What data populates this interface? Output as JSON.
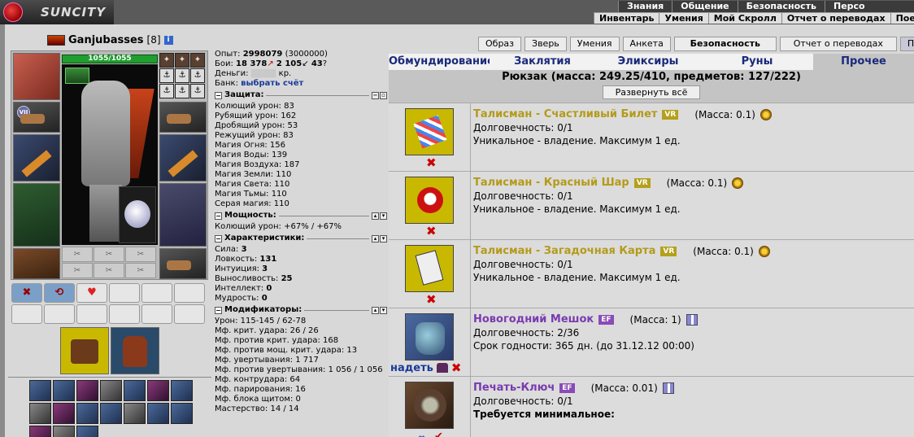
{
  "top": {
    "logo": "SUNCITY",
    "menu1": [
      "Знания",
      "Общение",
      "Безопасность",
      "Персо"
    ],
    "menu2": [
      "Инвентарь",
      "Умения",
      "Мой Скролл",
      "Отчет о переводах",
      "Поединки"
    ]
  },
  "char": {
    "name": "Ganjubasses",
    "level": "[8]",
    "info": "i",
    "hp": "1055/1055",
    "vii": "VII",
    "rings": [
      "✦",
      "✦",
      "✦",
      "⚓",
      "⚓",
      "⚓",
      "⚓",
      "⚓",
      "⚓"
    ],
    "small_slots": [
      "✂",
      "✂",
      "✂",
      "✂",
      "✂",
      "✂"
    ],
    "scrolls": [
      "✖",
      "⟲",
      "♥",
      "",
      "",
      "",
      "",
      "",
      "",
      "",
      "",
      ""
    ]
  },
  "stats": {
    "exp_label": "Опыт:",
    "exp_value": "2998079",
    "exp_next": "(3000000)",
    "fights_label": "Бои:",
    "wins": "18 378",
    "losses": "2 105",
    "draws": "43",
    "money_label": "Деньги:",
    "money_value": "кр.",
    "bank_label": "Банк:",
    "bank_link": "выбрать счёт",
    "sec_defense": "Защита:",
    "defense": [
      "Колющий урон: 83",
      "Рубящий урон: 162",
      "Дробящий урон: 53",
      "Режущий урон: 83",
      "Магия Огня: 156",
      "Магия Воды: 139",
      "Магия Воздуха: 187",
      "Магия Земли: 110",
      "Магия Света: 110",
      "Магия Тьмы: 110",
      "Серая магия: 110"
    ],
    "sec_power": "Мощность:",
    "power": [
      "Колющий урон: +67% / +67%"
    ],
    "sec_chars": "Характеристики:",
    "chars": [
      {
        "label": "Сила:",
        "value": "3"
      },
      {
        "label": "Ловкость:",
        "value": "131"
      },
      {
        "label": "Интуиция:",
        "value": "3"
      },
      {
        "label": "Выносливость:",
        "value": "25"
      },
      {
        "label": "Интеллект:",
        "value": "0"
      },
      {
        "label": "Мудрость:",
        "value": "0"
      }
    ],
    "sec_mods": "Модификаторы:",
    "mods": [
      "Урон: 115-145 / 62-78",
      "Мф. крит. удара: 26 / 26",
      "Мф. против крит. удара: 168",
      "Мф. против мощ. крит. удара: 13",
      "Мф. увертывания: 1 717",
      "Мф. против увертывания: 1 056 / 1 056",
      "Мф. контрудара: 64",
      "Мф. парирования: 16",
      "Мф. блока щитом: 0",
      "Мастерство: 14 / 14"
    ]
  },
  "buttons": [
    "Образ",
    "Зверь",
    "Умения",
    "Анкета",
    "Безопасность",
    "Отчет о переводах",
    "Подск"
  ],
  "tabs": [
    "Обмундирование",
    "Заклятия",
    "Эликсиры",
    "Руны",
    "Прочее"
  ],
  "backpack": {
    "title": "Рюкзак (масса: 249.25/410, предметов: 127/222)",
    "expand": "Развернуть всё"
  },
  "items": [
    {
      "name": "Талисман - Счастливый Билет",
      "badge": "VR",
      "mass": "(Масса: 0.1)",
      "line1": "Долговечность: 0/1",
      "line2": "Уникальное - владение. Максимум 1 ед."
    },
    {
      "name": "Талисман - Красный Шар",
      "badge": "VR",
      "mass": "(Масса: 0.1)",
      "line1": "Долговечность: 0/1",
      "line2": "Уникальное - владение. Максимум 1 ед."
    },
    {
      "name": "Талисман - Загадочная Карта",
      "badge": "VR",
      "mass": "(Масса: 0.1)",
      "line1": "Долговечность: 0/1",
      "line2": "Уникальное - владение. Максимум 1 ед."
    },
    {
      "name": "Новогодний Мешок",
      "badge": "EF",
      "mass": "(Масса: 1)",
      "line1": "Долговечность: 2/36",
      "line2": "Срок годности: 365 дн. (до 31.12.12 00:00)",
      "wear": "надеть"
    },
    {
      "name": "Печать-Ключ",
      "badge": "EF",
      "mass": "(Масса: 0.01)",
      "line1": "Долговечность: 0/1",
      "line2": "Требуется минимальное:"
    }
  ],
  "icons": {
    "delete": "✖",
    "check": "✔",
    "arrows": "⇔"
  }
}
